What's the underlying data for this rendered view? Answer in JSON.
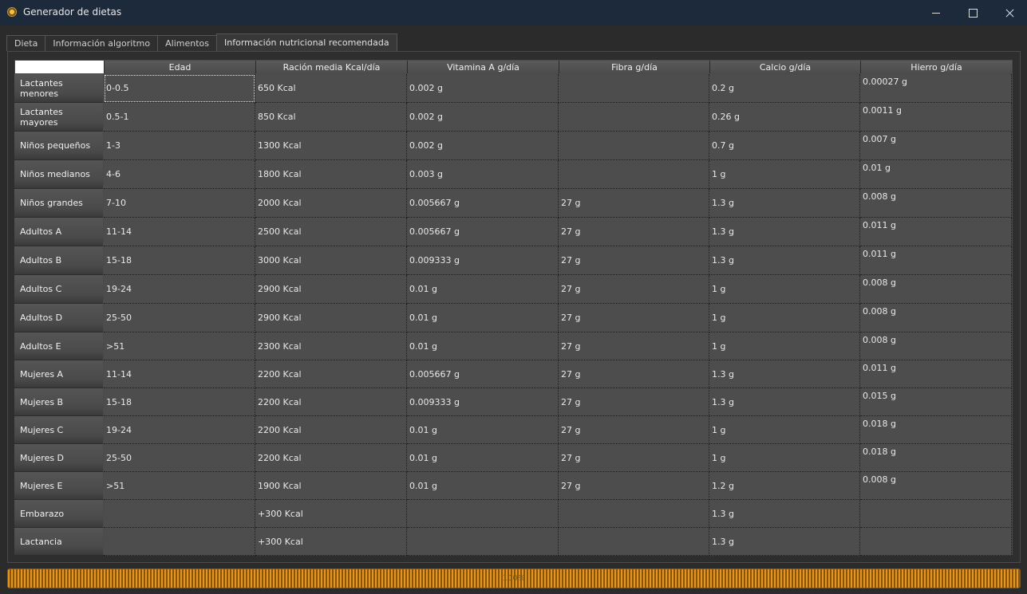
{
  "window": {
    "title": "Generador de dietas"
  },
  "tabs": [
    {
      "label": "Dieta"
    },
    {
      "label": "Información algoritmo"
    },
    {
      "label": "Alimentos"
    },
    {
      "label": "Información nutricional recomendada"
    }
  ],
  "active_tab": 3,
  "table": {
    "columns": [
      "Edad",
      "Ración media Kcal/día",
      "Vitamina A g/día",
      "Fibra g/día",
      "Calcio g/día",
      "Hierro g/día"
    ],
    "rows": [
      {
        "label": "Lactantes menores",
        "cells": [
          "0-0.5",
          "650 Kcal",
          "0.002 g",
          "",
          "0.2 g",
          "0.00027 g"
        ]
      },
      {
        "label": "Lactantes mayores",
        "cells": [
          "0.5-1",
          "850 Kcal",
          "0.002 g",
          "",
          "0.26 g",
          "0.0011 g"
        ]
      },
      {
        "label": "Niños pequeños",
        "cells": [
          "1-3",
          "1300 Kcal",
          "0.002 g",
          "",
          "0.7 g",
          "0.007 g"
        ]
      },
      {
        "label": "Niños medianos",
        "cells": [
          "4-6",
          "1800  Kcal",
          "0.003 g",
          "",
          "1 g",
          "0.01 g"
        ]
      },
      {
        "label": "Niños grandes",
        "cells": [
          "7-10",
          "2000 Kcal",
          "0.005667 g",
          "27 g",
          "1.3 g",
          "0.008 g"
        ]
      },
      {
        "label": "Adultos A",
        "cells": [
          "11-14",
          "2500 Kcal",
          "0.005667 g",
          "27 g",
          "1.3 g",
          "0.011 g"
        ]
      },
      {
        "label": "Adultos B",
        "cells": [
          "15-18",
          "3000 Kcal",
          "0.009333 g",
          "27 g",
          "1.3 g",
          "0.011 g"
        ]
      },
      {
        "label": "Adultos C",
        "cells": [
          "19-24",
          "2900 Kcal",
          "0.01 g",
          "27 g",
          "1 g",
          "0.008 g"
        ]
      },
      {
        "label": "Adultos D",
        "cells": [
          "25-50",
          "2900 Kcal",
          "0.01 g",
          "27 g",
          "1 g",
          "0.008 g"
        ]
      },
      {
        "label": "Adultos E",
        "cells": [
          ">51",
          "2300 Kcal",
          "0.01 g",
          "27 g",
          "1 g",
          "0.008 g"
        ]
      },
      {
        "label": "Mujeres A",
        "cells": [
          "11-14",
          "2200 Kcal",
          "0.005667 g",
          "27 g",
          "1.3 g",
          "0.011 g"
        ]
      },
      {
        "label": "Mujeres B",
        "cells": [
          "15-18",
          "2200 Kcal",
          "0.009333 g",
          "27 g",
          "1.3 g",
          "0.015 g"
        ]
      },
      {
        "label": "Mujeres C",
        "cells": [
          "19-24",
          "2200 Kcal",
          "0.01 g",
          "27 g",
          "1 g",
          "0.018 g"
        ]
      },
      {
        "label": "Mujeres D",
        "cells": [
          "25-50",
          "2200 Kcal",
          "0.01 g",
          "27 g",
          "1 g",
          "0.018 g"
        ]
      },
      {
        "label": "Mujeres E",
        "cells": [
          ">51",
          "1900 Kcal",
          "0.01 g",
          "27 g",
          "1.2 g",
          "0.008 g"
        ]
      },
      {
        "label": "Embarazo",
        "cells": [
          "",
          "+300 Kcal",
          "",
          "",
          "1.3 g",
          ""
        ]
      },
      {
        "label": "Lactancia",
        "cells": [
          "",
          "+300 Kcal",
          "",
          "",
          "1.3 g",
          ""
        ]
      }
    ],
    "selected_cell": {
      "row": 0,
      "col": 0
    }
  },
  "progress": {
    "label": "100%",
    "value": 1.0
  },
  "colors": {
    "accent": "#e3951e",
    "titlebar": "#1d2a3b"
  }
}
